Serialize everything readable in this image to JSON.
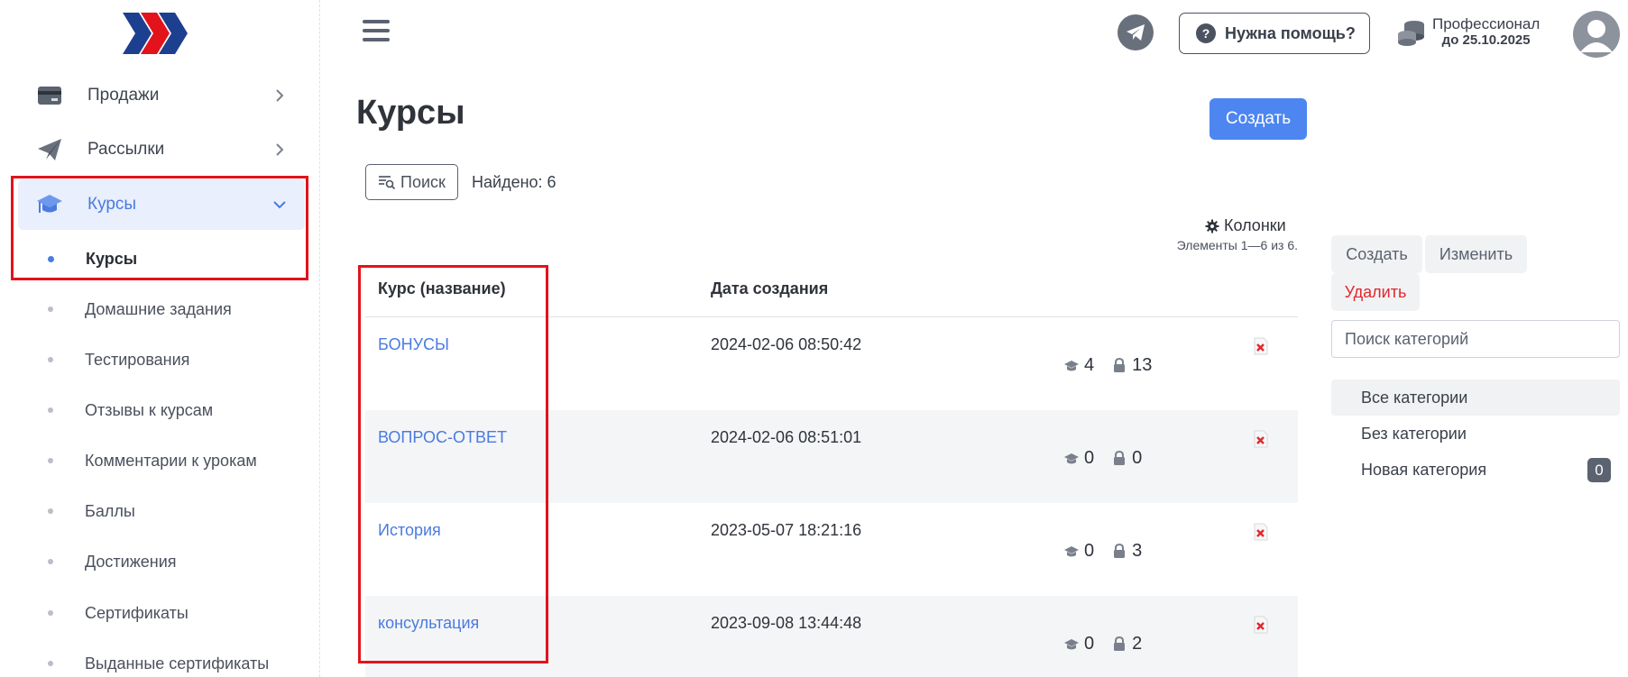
{
  "sidebar": {
    "menu": [
      {
        "label": "Продажи",
        "icon": "credit-card-icon"
      },
      {
        "label": "Рассылки",
        "icon": "paper-plane-icon"
      },
      {
        "label": "Курсы",
        "icon": "graduation-cap-icon",
        "active": true
      }
    ],
    "submenu": [
      {
        "label": "Курсы",
        "current": true
      },
      {
        "label": "Домашние задания"
      },
      {
        "label": "Тестирования"
      },
      {
        "label": "Отзывы к курсам"
      },
      {
        "label": "Комментарии к урокам"
      },
      {
        "label": "Баллы"
      },
      {
        "label": "Достижения"
      },
      {
        "label": "Сертификаты"
      },
      {
        "label": "Выданные сертификаты"
      }
    ]
  },
  "topbar": {
    "help_label": "Нужна помощь?",
    "plan_name": "Профессионал",
    "plan_date": "до 25.10.2025"
  },
  "main": {
    "title": "Курсы",
    "create_label": "Создать",
    "search_label": "Поиск",
    "found_text": "Найдено: 6",
    "columns_label": "Колонки",
    "elements_info": "Элементы 1—6 из 6.",
    "table": {
      "headers": [
        "Курс (название)",
        "Дата создания"
      ],
      "rows": [
        {
          "title": "БОНУСЫ",
          "date": "2024-02-06 08:50:42",
          "students": "4",
          "locked": "13"
        },
        {
          "title": "ВОПРОС-ОТВЕТ",
          "date": "2024-02-06 08:51:01",
          "students": "0",
          "locked": "0"
        },
        {
          "title": "История",
          "date": "2023-05-07 18:21:16",
          "students": "0",
          "locked": "3"
        },
        {
          "title": "консультация",
          "date": "2023-09-08 13:44:48",
          "students": "0",
          "locked": "2"
        }
      ]
    }
  },
  "categories": {
    "create_label": "Создать",
    "edit_label": "Изменить",
    "delete_label": "Удалить",
    "search_placeholder": "Поиск категорий",
    "items": [
      {
        "label": "Все категории",
        "selected": true
      },
      {
        "label": "Без категории"
      },
      {
        "label": "Новая категория",
        "count": "0"
      }
    ]
  },
  "colors": {
    "accent": "#4d86f0",
    "link": "#4a7be0",
    "danger": "#e0282e",
    "highlight": "#e3131b"
  }
}
